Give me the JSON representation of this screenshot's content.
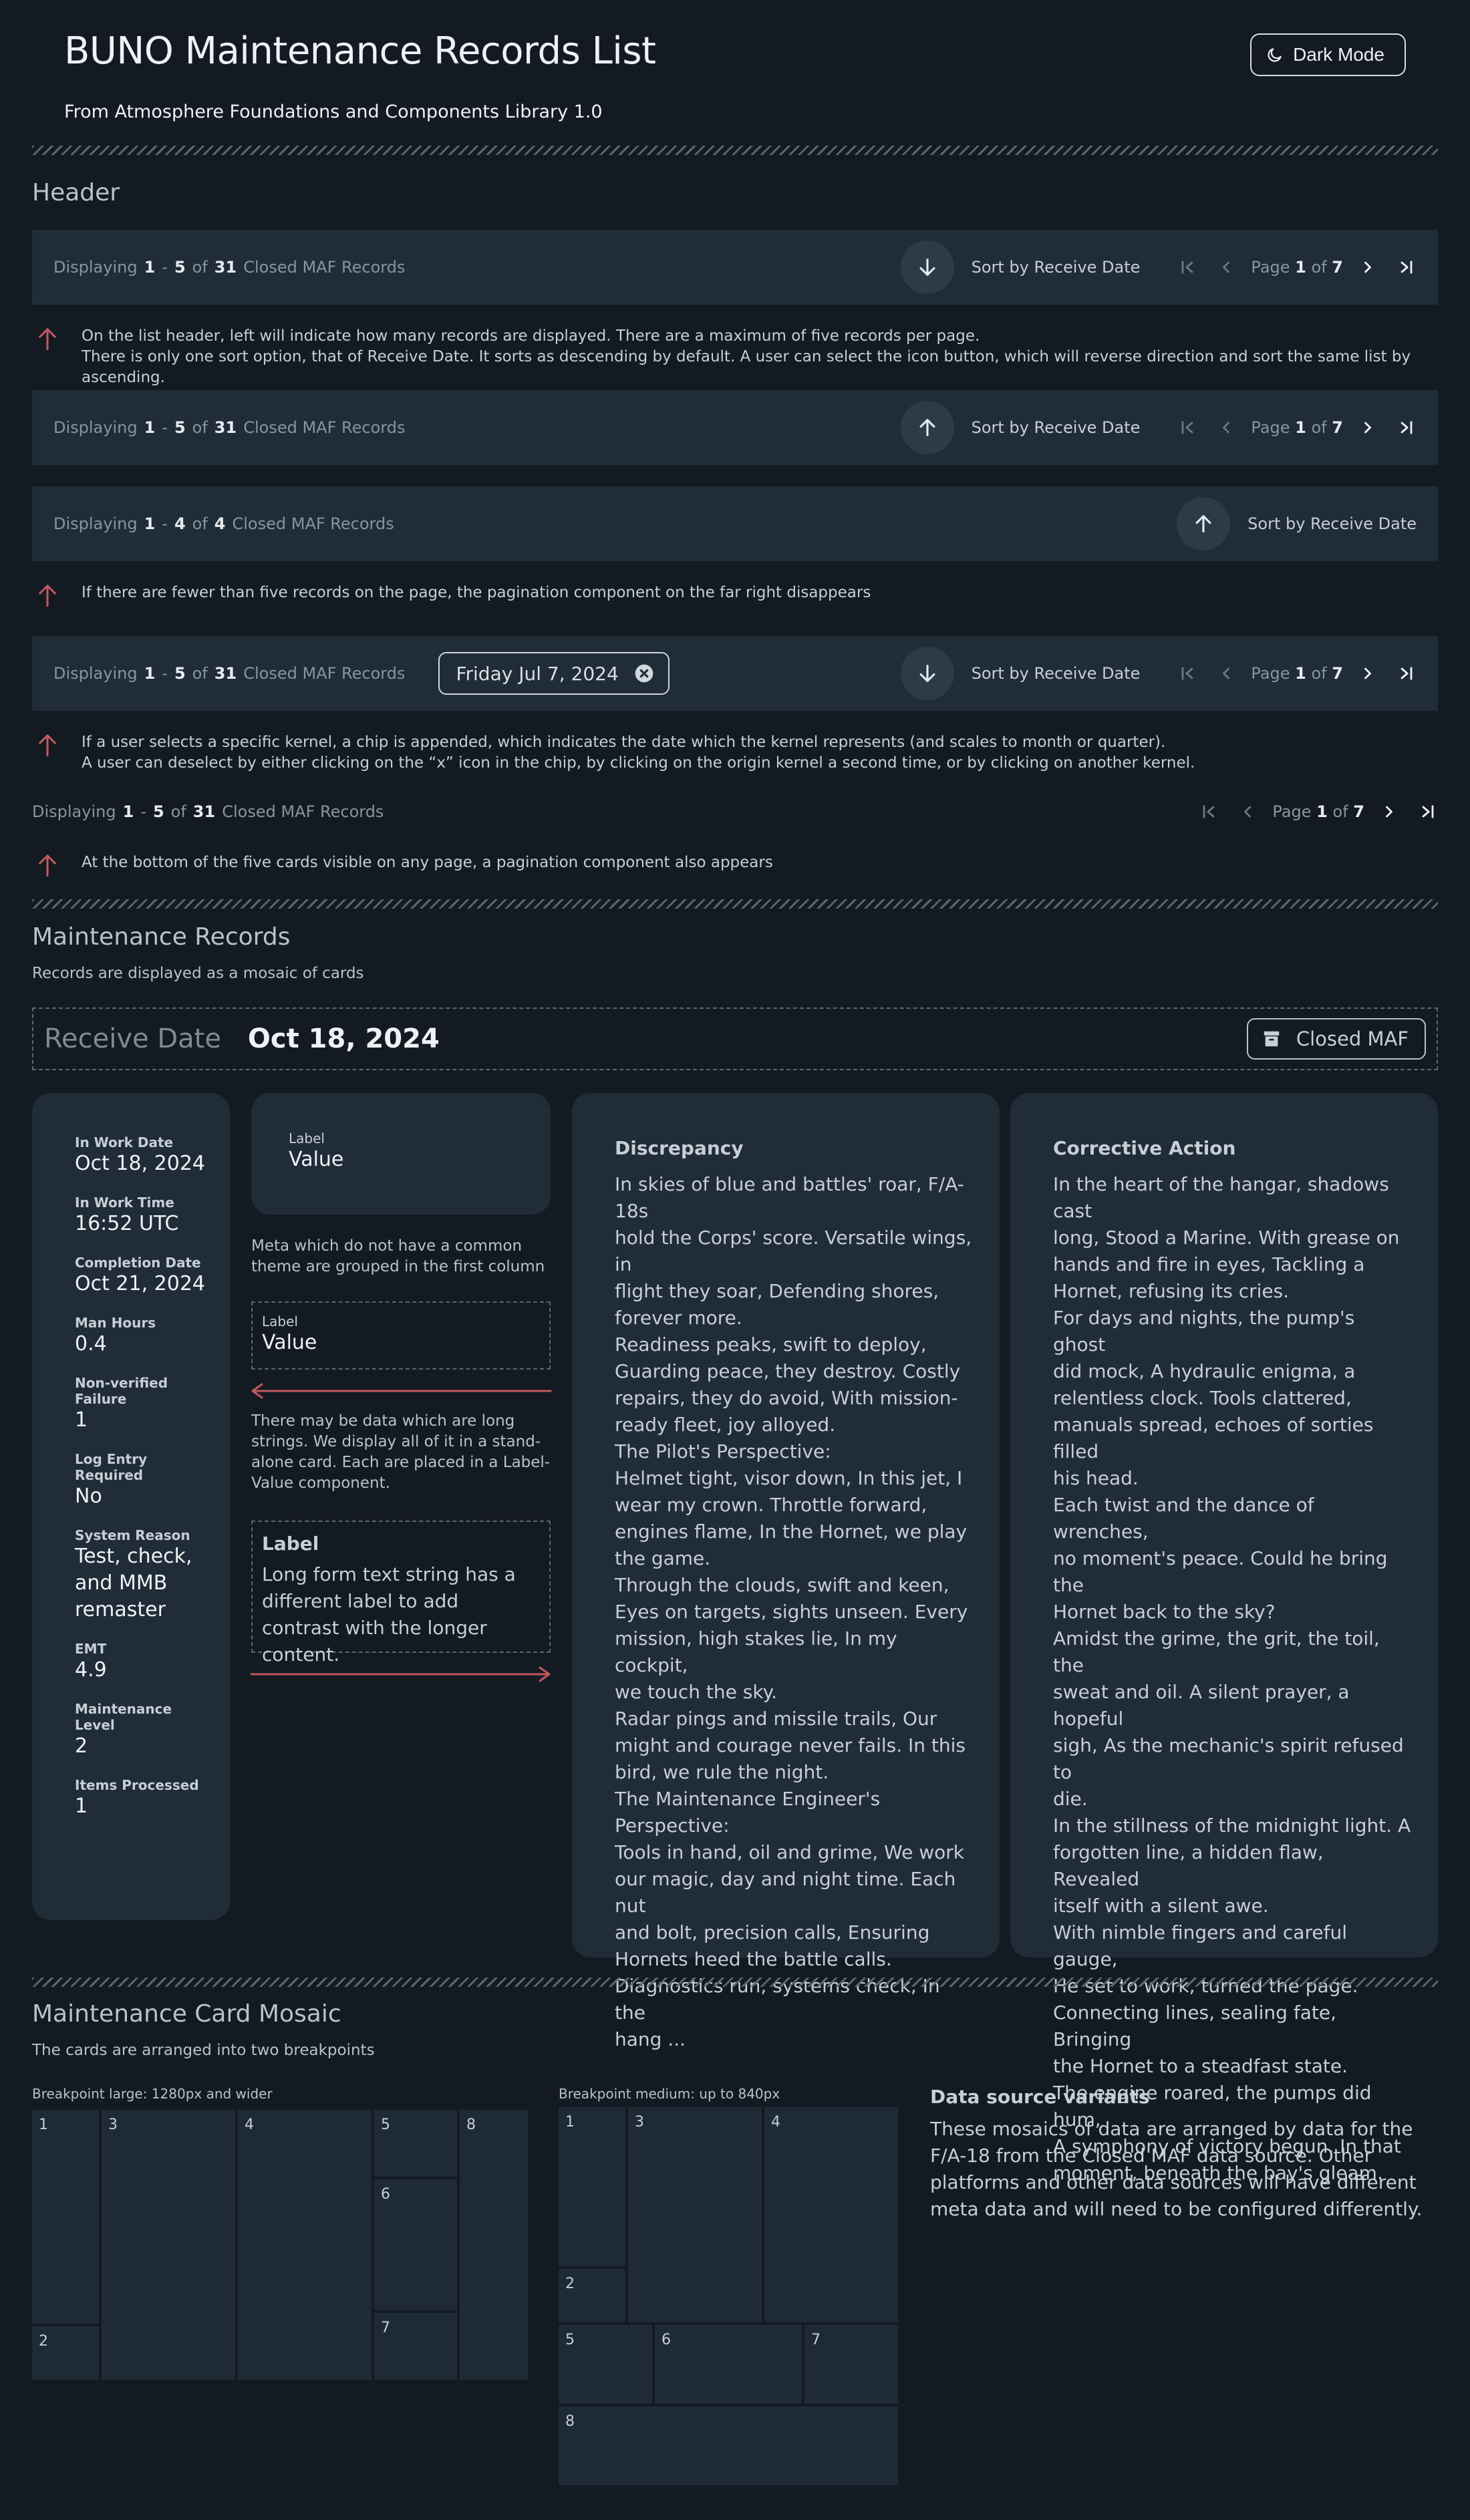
{
  "page": {
    "title": "BUNO Maintenance Records List",
    "subtitle": "From Atmosphere Foundations and Components Library 1.0",
    "dark_mode_label": "Dark Mode"
  },
  "header_section": {
    "title": "Header",
    "bar1": {
      "prefix": "Displaying",
      "from": "1",
      "dash": "-",
      "to": "5",
      "of": "of",
      "total": "31",
      "suffix": "Closed MAF Records",
      "sort_label": "Sort by Receive Date",
      "sort_dir": "down",
      "page_word": "Page",
      "page": "1",
      "of2": "of",
      "pages": "7"
    },
    "note1": [
      "On the list header, left will indicate how many records are displayed. There are a maximum of five records per page.",
      "There is only one sort option, that of Receive Date. It sorts as descending by default. A user can select the icon button, which will reverse direction and sort the same list by ascending."
    ],
    "bar2": {
      "prefix": "Displaying",
      "from": "1",
      "dash": "-",
      "to": "5",
      "of": "of",
      "total": "31",
      "suffix": "Closed MAF Records",
      "sort_label": "Sort by Receive Date",
      "sort_dir": "up",
      "page_word": "Page",
      "page": "1",
      "of2": "of",
      "pages": "7"
    },
    "bar3": {
      "prefix": "Displaying",
      "from": "1",
      "dash": "-",
      "to": "4",
      "of": "of",
      "total": "4",
      "suffix": "Closed MAF Records",
      "sort_label": "Sort by Receive Date",
      "sort_dir": "up"
    },
    "note2": [
      "If there are fewer than five records on the page, the pagination component on the far right disappears"
    ],
    "bar4": {
      "prefix": "Displaying",
      "from": "1",
      "dash": "-",
      "to": "5",
      "of": "of",
      "total": "31",
      "suffix": "Closed MAF Records",
      "chip": "Friday Jul 7, 2024",
      "sort_label": "Sort by Receive Date",
      "sort_dir": "down",
      "page_word": "Page",
      "page": "1",
      "of2": "of",
      "pages": "7"
    },
    "note3": [
      "If a user selects a specific kernel, a chip is appended, which indicates the date which the kernel represents (and scales to month or quarter).",
      "A user can deselect by either clicking on the “x” icon in the chip, by clicking on the origin kernel a second time, or by clicking on another kernel."
    ],
    "bar5": {
      "prefix": "Displaying",
      "from": "1",
      "dash": "-",
      "to": "5",
      "of": "of",
      "total": "31",
      "suffix": "Closed MAF Records",
      "page_word": "Page",
      "page": "1",
      "of2": "of",
      "pages": "7"
    },
    "note4": [
      "At the bottom of the five cards visible on any page, a pagination component also appears"
    ]
  },
  "records_section": {
    "title": "Maintenance Records",
    "subtitle": "Records are displayed as a mosaic of cards",
    "receive_label": "Receive Date",
    "receive_value": "Oct 18, 2024",
    "closed_btn": "Closed MAF",
    "meta": [
      {
        "label": "In Work Date",
        "value": "Oct 18, 2024"
      },
      {
        "label": "In Work Time",
        "value": "16:52 UTC"
      },
      {
        "label": "Completion Date",
        "value": "Oct 21, 2024"
      },
      {
        "label": "Man Hours",
        "value": "0.4"
      },
      {
        "label": "Non-verified\nFailure",
        "value": "1"
      },
      {
        "label": "Log Entry\nRequired",
        "value": "No"
      },
      {
        "label": "System Reason",
        "value": "Test, check,\nand MMB\nremaster"
      },
      {
        "label": "EMT",
        "value": "4.9"
      },
      {
        "label": "Maintenance\nLevel",
        "value": "2"
      },
      {
        "label": "Items Processed",
        "value": "1"
      }
    ],
    "label_card": {
      "label": "Label",
      "value": "Value"
    },
    "note_meta": "Meta which do not have a common theme are grouped in the first column",
    "label_box": {
      "label": "Label",
      "value": "Value"
    },
    "note_long": "There may be data which are long strings. We display all of it in a stand-alone card. Each are placed in a Label-Value component.",
    "long_box": {
      "label": "Label",
      "value": "Long form text string has a different label to add contrast with the longer content."
    },
    "discrepancy": {
      "title": "Discrepancy",
      "text": "In skies of blue and battles' roar, F/A-18s\nhold the Corps' score. Versatile wings, in\nflight they soar, Defending shores,\nforever more.\nReadiness peaks, swift to deploy,\nGuarding peace, they destroy. Costly\nrepairs, they do avoid, With mission-\nready fleet, joy alloyed.\nThe Pilot's Perspective:\nHelmet tight, visor down, In this jet, I\nwear my crown. Throttle forward,\nengines flame, In the Hornet, we play\nthe game.\nThrough the clouds, swift and keen,\nEyes on targets, sights unseen. Every\nmission, high stakes lie, In my cockpit,\nwe touch the sky.\nRadar pings and missile trails, Our\nmight and courage never fails. In this\nbird, we rule the night.\nThe Maintenance Engineer's\nPerspective:\nTools in hand, oil and grime, We work\nour magic, day and night time. Each nut\nand bolt, precision calls, Ensuring\nHornets heed the battle calls.\nDiagnostics run, systems check, In the\nhang ..."
    },
    "corrective": {
      "title": "Corrective Action",
      "text": "In the heart of the hangar, shadows cast\nlong, Stood a Marine. With grease on\nhands and fire in eyes, Tackling a\nHornet, refusing its cries.\nFor days and nights, the pump's ghost\ndid mock, A hydraulic enigma, a\nrelentless clock. Tools clattered,\nmanuals spread, echoes of sorties filled\nhis head.\nEach twist and the dance of wrenches,\nno moment's peace. Could he bring the\nHornet back to the sky?\nAmidst the grime, the grit, the toil, the\nsweat and oil. A silent prayer, a hopeful\nsigh, As the mechanic's spirit refused to\ndie.\nIn the stillness of the midnight light. A\nforgotten line, a hidden flaw, Revealed\nitself with a silent awe.\nWith nimble fingers and careful gauge,\nHe set to work, turned the page.\nConnecting lines, sealing fate, Bringing\nthe Hornet to a steadfast state.\nThe engine roared, the pumps did hum,\nA symphony of victory begun. In that\nmoment, beneath the bay's gleam."
    }
  },
  "mosaic_section": {
    "title": "Maintenance Card Mosaic",
    "subtitle": "The cards are arranged into two breakpoints",
    "large_label": "Breakpoint large: 1280px and wider",
    "medium_label": "Breakpoint medium: up to 840px",
    "large_tiles": [
      "1",
      "2",
      "3",
      "4",
      "5",
      "6",
      "7",
      "8"
    ],
    "medium_tiles": [
      "1",
      "2",
      "3",
      "4",
      "5",
      "6",
      "7",
      "8"
    ],
    "ds_title": "Data source variants",
    "ds_text": "These mosaics of data are arranged by data for the F/A-18 from the Closed MAF data source. Other platforms and other data sources will have different meta data and will need to be configured differently."
  },
  "colors": {
    "bg": "#141a22",
    "bar": "#202c38",
    "card": "#202c38",
    "arrow_accent": "#c0585e"
  }
}
